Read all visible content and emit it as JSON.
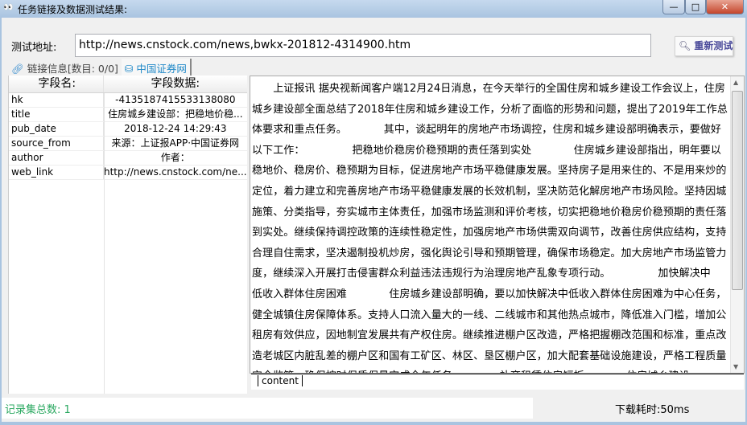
{
  "window": {
    "title": "任务链接及数据测试结果:",
    "icon": "eyes-icon",
    "minimize": "—",
    "maximize": "□",
    "close": "✕"
  },
  "toolbar": {
    "url_label": "测试地址:",
    "url_value": "http://news.cnstock.com/news,bwkx-201812-4314900.htm",
    "retest_label": "重新测试",
    "retest_icon": "search-icon"
  },
  "tabs": [
    {
      "label": "链接信息[数目: 0/0]",
      "icon": "link-icon"
    },
    {
      "label": "中国证券网",
      "icon": "database-icon"
    }
  ],
  "grid": {
    "headers": [
      "字段名:",
      "字段数据:"
    ],
    "rows": [
      [
        "hk",
        "-4135187415533138080"
      ],
      [
        "title",
        "住房城乡建设部：把稳地价稳..."
      ],
      [
        "pub_date",
        "2018-12-24 14:29:43"
      ],
      [
        "source_from",
        "来源：上证报APP·中国证券网"
      ],
      [
        "author",
        "作者："
      ],
      [
        "web_link",
        "http://news.cnstock.com/ne..."
      ]
    ]
  },
  "content": {
    "tab_label": "content",
    "lines": [
      "　　上证报讯 据央视新闻客户端12月24日消息，在今天举行的全国住房和城乡建设工作会议上，住房",
      "城乡建设部全面总结了2018年住房和城乡建设工作，分析了面临的形势和问题，提出了2019年工作总",
      "体要求和重点任务。　　　　其中，谈起明年的房地产市场调控，住房和城乡建设部明确表示，要做好",
      "以下工作：　　　　　把稳地价稳房价稳预期的责任落到实处　　　　住房城乡建设部指出，明年要以",
      "稳地价、稳房价、稳预期为目标，促进房地产市场平稳健康发展。坚持房子是用来住的、不是用来炒的",
      "定位，着力建立和完善房地产市场平稳健康发展的长效机制，坚决防范化解房地产市场风险。坚持因城",
      "施策、分类指导，夯实城市主体责任，加强市场监测和评价考核，切实把稳地价稳房价稳预期的责任落",
      "到实处。继续保持调控政策的连续性稳定性，加强房地产市场供需双向调节，改善住房供应结构，支持",
      "合理自住需求，坚决遏制投机炒房，强化舆论引导和预期管理，确保市场稳定。加大房地产市场监管力",
      "度，继续深入开展打击侵害群众利益违法违规行为治理房地产乱象专项行动。　　　　　加快解决中",
      "低收入群体住房困难　　　　住房城乡建设部明确，要以加快解决中低收入群体住房困难为中心任务，",
      "健全城镇住房保障体系。支持人口流入量大的一线、二线城市和其他热点城市，降低准入门槛，增加公",
      "租房有效供应，因地制宜发展共有产权住房。继续推进棚户区改造，严格把握棚改范围和标准，重点改",
      "造老城区内脏乱差的棚户区和国有工矿区、林区、垦区棚户区，加大配套基础设施建设，严格工程质量",
      "安全监管，确保按时保质保量完成全年任务。　　　　补齐租赁住房短板　　　　住房城乡建设"
    ]
  },
  "status": {
    "record_count": "记录集总数: 1",
    "download_time": "下载耗时:50ms",
    "count_color": "#2aa860"
  }
}
